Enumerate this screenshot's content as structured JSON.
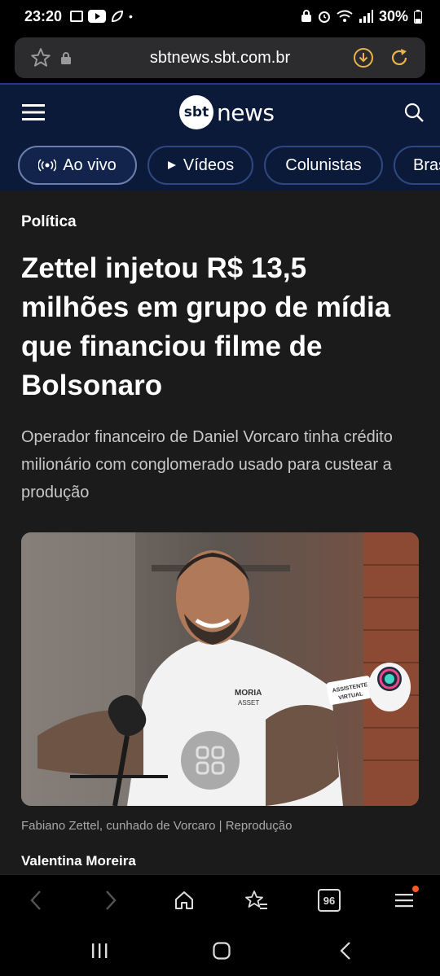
{
  "status_bar": {
    "time": "23:20",
    "battery": "30%"
  },
  "browser": {
    "url": "sbtnews.sbt.com.br",
    "tab_count": "96"
  },
  "site": {
    "logo_mark": "sbt",
    "logo_text": "news"
  },
  "tabs": [
    {
      "label": "Ao vivo",
      "icon": "broadcast-icon"
    },
    {
      "label": "Vídeos",
      "icon": "play-icon"
    },
    {
      "label": "Colunistas"
    },
    {
      "label": "Bras"
    }
  ],
  "article": {
    "category": "Política",
    "headline": "Zettel injetou R$ 13,5 milhões em grupo de mídia que financiou filme de Bolsonaro",
    "subhead": "Operador financeiro de Daniel Vorcaro tinha crédito milionário com conglomerado usado para custear a produção",
    "photo": {
      "shirt_logo": "MORIA ASSET",
      "sticker_text": "ASSISTENTE VIRTUAL"
    },
    "caption": "Fabiano Zettel, cunhado de Vorcaro | Reprodução",
    "author": "Valentina Moreira"
  },
  "colors": {
    "header_bg": "#0c1a3a",
    "page_bg": "#1b1b1b",
    "notification_dot": "#ff5a1f"
  }
}
